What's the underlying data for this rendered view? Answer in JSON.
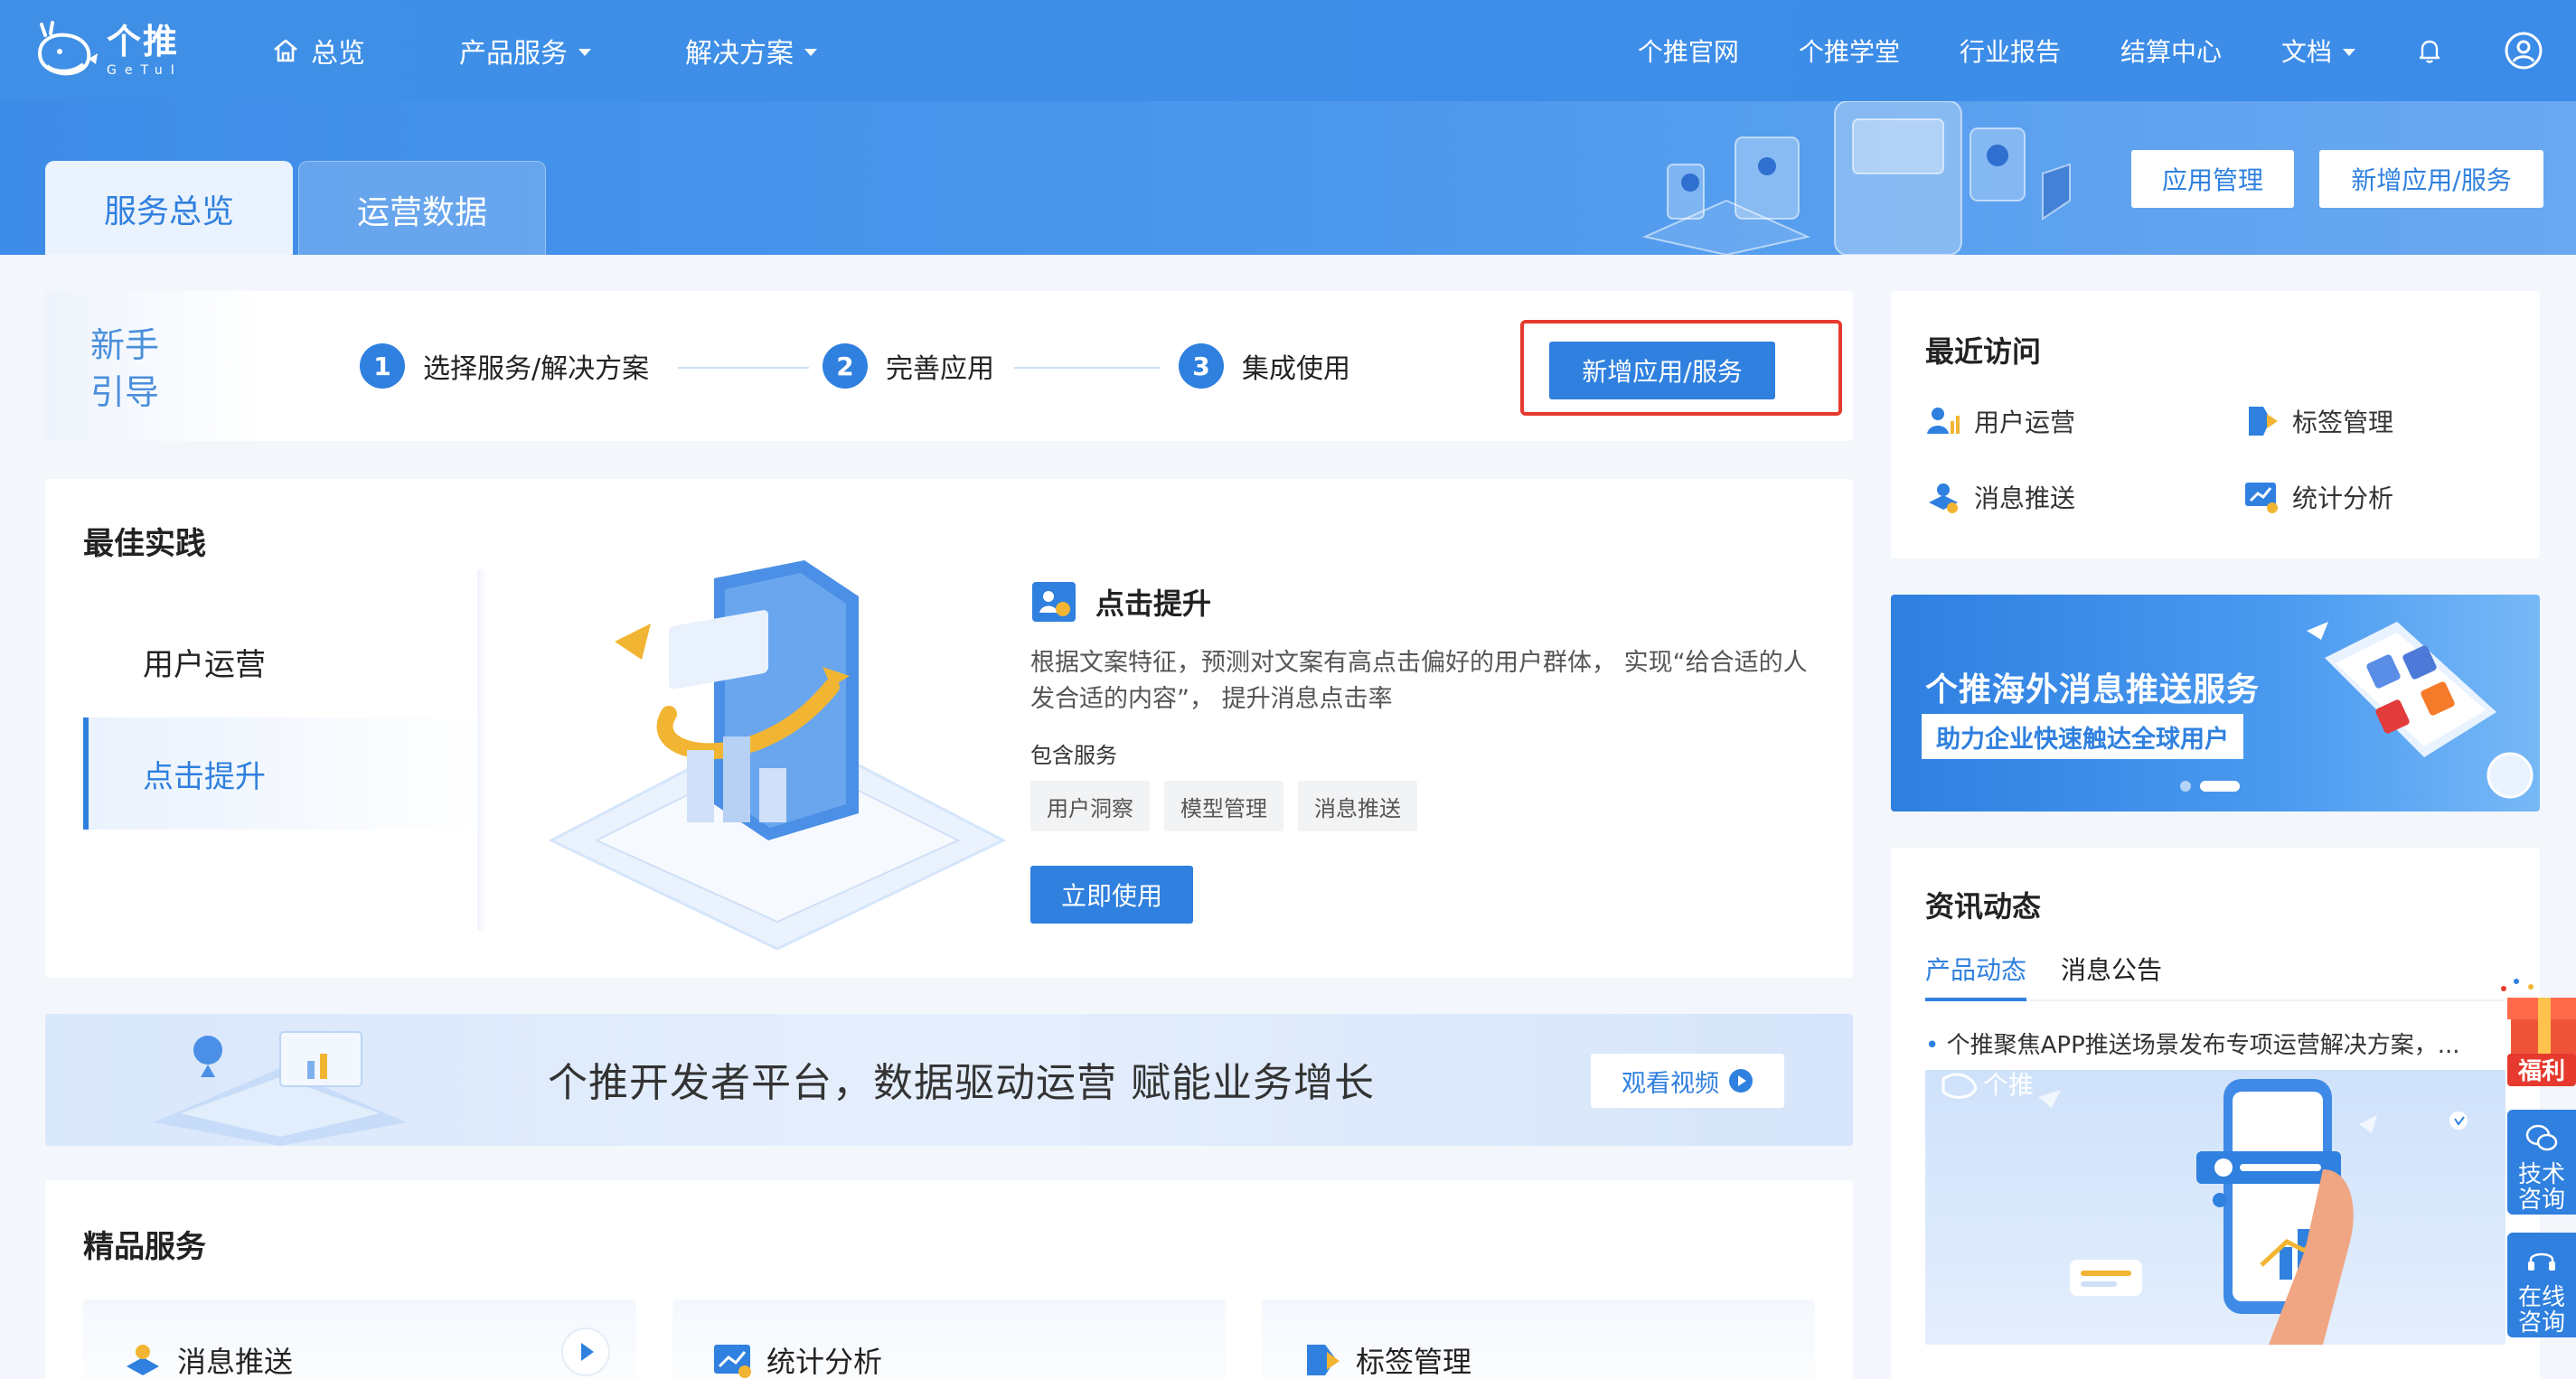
{
  "brand": {
    "name_cn": "个推",
    "name_en": "GeTuI"
  },
  "topnav": {
    "left": [
      {
        "label": "总览",
        "icon": "home-icon",
        "caret": false
      },
      {
        "label": "产品服务",
        "caret": true
      },
      {
        "label": "解决方案",
        "caret": true
      }
    ],
    "right": [
      "个推官网",
      "个推学堂",
      "行业报告",
      "结算中心"
    ],
    "docs": "文档"
  },
  "hero": {
    "tabs": [
      "服务总览",
      "运营数据"
    ],
    "buttons": [
      "应用管理",
      "新增应用/服务"
    ]
  },
  "guide": {
    "title_line1": "新手",
    "title_line2": "引导",
    "steps": [
      {
        "num": "1",
        "label": "选择服务/解决方案"
      },
      {
        "num": "2",
        "label": "完善应用"
      },
      {
        "num": "3",
        "label": "集成使用"
      }
    ],
    "button": "新增应用/服务"
  },
  "best_practice": {
    "title": "最佳实践",
    "menu": [
      "用户运营",
      "点击提升"
    ],
    "heading": "点击提升",
    "description": "根据文案特征，预测对文案有高点击偏好的用户群体， 实现“给合适的人发合适的内容”， 提升消息点击率",
    "sub": "包含服务",
    "chips": [
      "用户洞察",
      "模型管理",
      "消息推送"
    ],
    "button": "立即使用"
  },
  "strip": {
    "text": "个推开发者平台，数据驱动运营 赋能业务增长",
    "button": "观看视频"
  },
  "premium": {
    "title": "精品服务",
    "cards": [
      "消息推送",
      "统计分析",
      "标签管理"
    ]
  },
  "recent": {
    "title": "最近访问",
    "items": [
      "用户运营",
      "标签管理",
      "消息推送",
      "统计分析"
    ]
  },
  "promo": {
    "title": "个推海外消息推送服务",
    "sub": "助力企业快速触达全球用户"
  },
  "news": {
    "title": "资讯动态",
    "tabs": [
      "产品动态",
      "消息公告"
    ],
    "item": "个推聚焦APP推送场景发布专项运营解决方案，...",
    "image_brand": "个推"
  },
  "float": {
    "gift": "福利",
    "tech": "技术咨询",
    "online": "在线咨询"
  },
  "colors": {
    "primary": "#2f80df",
    "nav": "#3f8fe6",
    "highlight": "#e63a2e"
  }
}
